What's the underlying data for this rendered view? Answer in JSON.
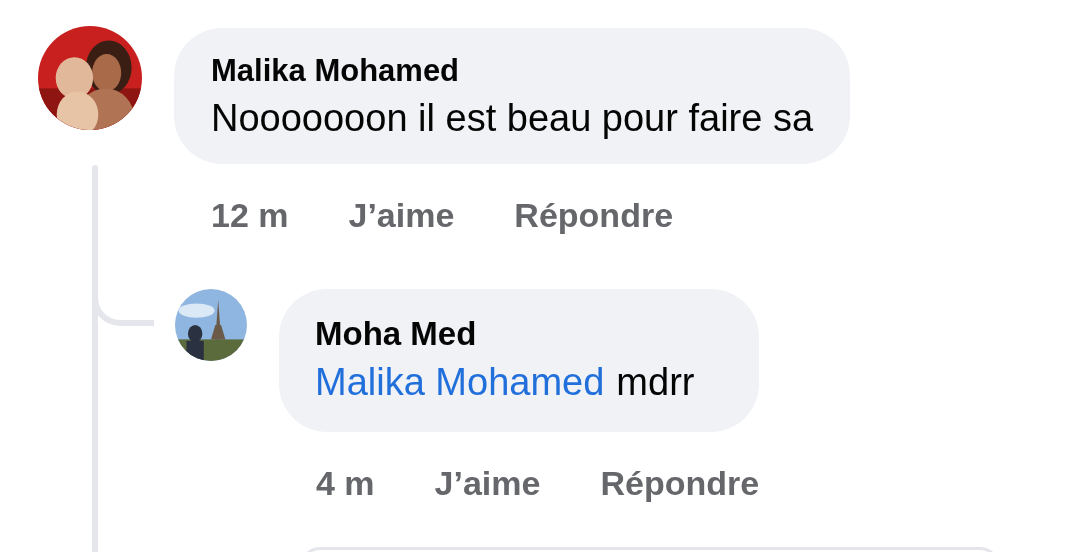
{
  "comments": [
    {
      "author": "Malika Mohamed",
      "text": "Nooooooon il est beau pour faire sa",
      "avatar": {
        "kind": "picture"
      },
      "time": "12 m",
      "actions": [
        "J’aime",
        "Répondre"
      ],
      "children": [
        {
          "author": "Moha Med",
          "mention": "Malika Mohamed",
          "text": "mdrr",
          "avatar": {
            "kind": "picture"
          },
          "time": "4 m",
          "actions": [
            "J’aime",
            "Répondre"
          ]
        }
      ]
    }
  ]
}
